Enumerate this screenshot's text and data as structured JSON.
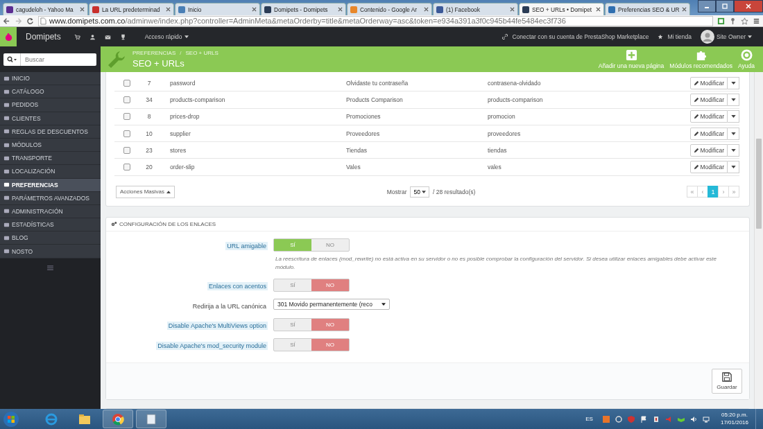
{
  "browser": {
    "tabs": [
      {
        "title": "cagudeloh - Yahoo Ma",
        "selected": false,
        "color": "#5b2d91"
      },
      {
        "title": "La URL predeterminad",
        "selected": false,
        "color": "#c8302c"
      },
      {
        "title": "Inicio",
        "selected": false,
        "color": "#4a7fb5"
      },
      {
        "title": "Domipets - Domipets",
        "selected": false,
        "color": "#2a3b55"
      },
      {
        "title": "Contenido - Google Ar",
        "selected": false,
        "color": "#e8872a"
      },
      {
        "title": "(1) Facebook",
        "selected": false,
        "color": "#3b5998"
      },
      {
        "title": "SEO + URLs • Domipet",
        "selected": true,
        "color": "#2a3b55"
      },
      {
        "title": "Preferencias SEO & UR",
        "selected": false,
        "color": "#2f6fb0"
      }
    ],
    "url_host": "www.domipets.com.co",
    "url_path": "/adminwe/index.php?controller=AdminMeta&metaOrderby=title&metaOrderway=asc&token=e934a391a3f0c945b44fe5484ec3f736"
  },
  "header": {
    "shop": "Domipets",
    "quick_access": "Acceso rápido",
    "marketplace": "Conectar con su cuenta de PrestaShop Marketplace",
    "my_shop": "Mi tienda",
    "user": "Site Owner"
  },
  "search": {
    "placeholder": "Buscar"
  },
  "sidebar": {
    "items": [
      {
        "label": "INICIO",
        "selected": false
      },
      {
        "label": "CATÁLOGO",
        "selected": false
      },
      {
        "label": "PEDIDOS",
        "selected": false
      },
      {
        "label": "CLIENTES",
        "selected": false
      },
      {
        "label": "REGLAS DE DESCUENTOS",
        "selected": false
      },
      {
        "label": "MÓDULOS",
        "selected": false
      },
      {
        "label": "TRANSPORTE",
        "selected": false
      },
      {
        "label": "LOCALIZACIÓN",
        "selected": false
      },
      {
        "label": "PREFERENCIAS",
        "selected": true
      },
      {
        "label": "PARÁMETROS AVANZADOS",
        "selected": false
      },
      {
        "label": "ADMINISTRACIÓN",
        "selected": false
      },
      {
        "label": "ESTADÍSTICAS",
        "selected": false
      },
      {
        "label": "BLOG",
        "selected": false
      },
      {
        "label": "NOSTO",
        "selected": false
      }
    ]
  },
  "toolbar": {
    "breadcrumb": [
      "PREFERENCIAS",
      "SEO + URLS"
    ],
    "separator": "/",
    "title": "SEO + URLs",
    "actions": [
      "Añadir una nueva página",
      "Módulos recomendados",
      "Ayuda"
    ]
  },
  "table": {
    "rows": [
      {
        "checked": false,
        "id": "7",
        "page": "password",
        "title": "Olvidaste tu contraseña",
        "url": "contrasena-olvidado",
        "action": "Modificar"
      },
      {
        "checked": false,
        "id": "34",
        "page": "products-comparison",
        "title": "Products Comparison",
        "url": "products-comparison",
        "action": "Modificar"
      },
      {
        "checked": false,
        "id": "8",
        "page": "prices-drop",
        "title": "Promociones",
        "url": "promocion",
        "action": "Modificar"
      },
      {
        "checked": false,
        "id": "10",
        "page": "supplier",
        "title": "Proveedores",
        "url": "proveedores",
        "action": "Modificar"
      },
      {
        "checked": false,
        "id": "23",
        "page": "stores",
        "title": "Tiendas",
        "url": "tiendas",
        "action": "Modificar"
      },
      {
        "checked": false,
        "id": "20",
        "page": "order-slip",
        "title": "Vales",
        "url": "vales",
        "action": "Modificar"
      }
    ],
    "bulk": "Acciones Masivas",
    "show_label": "Mostrar",
    "per_page": "50",
    "results": "/ 28 resultado(s)",
    "pages": [
      {
        "label": "«",
        "selected": false
      },
      {
        "label": "‹",
        "selected": false
      },
      {
        "label": "1",
        "selected": true
      },
      {
        "label": "›",
        "selected": false
      },
      {
        "label": "»",
        "selected": false
      }
    ]
  },
  "config": {
    "title": "CONFIGURACIÓN DE LOS ENLACES",
    "fields": [
      {
        "kind": "switch",
        "label": "URL amigable",
        "tooltip": true,
        "on": true,
        "yes": "SÍ",
        "no": "NO",
        "help": "La reescritura de enlaces (mod_rewrite) no está activa en su servidor o no es posible comprobar la configuración del servidor. Si desea utilizar enlaces amigables debe activar este módulo."
      },
      {
        "kind": "switch",
        "label": "Enlaces con acentos",
        "tooltip": true,
        "on": false,
        "yes": "SÍ",
        "no": "NO"
      },
      {
        "kind": "select",
        "label": "Redirija a la URL canónica",
        "tooltip": false,
        "value": "301 Movido permanentemente (reco"
      },
      {
        "kind": "switch",
        "label": "Disable Apache's MultiViews option",
        "tooltip": true,
        "on": false,
        "yes": "SÍ",
        "no": "NO"
      },
      {
        "kind": "switch",
        "label": "Disable Apache's mod_security module",
        "tooltip": true,
        "on": false,
        "yes": "SÍ",
        "no": "NO"
      }
    ],
    "save": "Guardar"
  },
  "taskbar": {
    "language": "ES",
    "time": "05:20 p.m.",
    "date": "17/01/2016"
  }
}
